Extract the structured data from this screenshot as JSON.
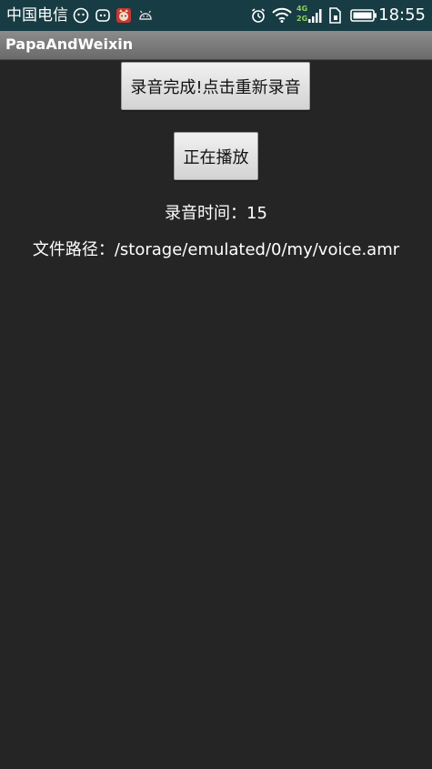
{
  "status_bar": {
    "carrier": "中国电信",
    "network_labels": [
      "4G",
      "2G"
    ],
    "time": "18:55",
    "background_color": "#173c44",
    "left_icons": [
      "wechat-icon",
      "chat-bubble-icon",
      "cat-app-icon",
      "android-icon"
    ],
    "right_icons": [
      "alarm-icon",
      "wifi-icon",
      "signal-icon",
      "sim-icon",
      "battery-icon"
    ]
  },
  "app_bar": {
    "title": "PapaAndWeixin"
  },
  "main": {
    "record_button_label": "录音完成!点击重新录音",
    "play_button_label": "正在播放",
    "record_time_label": "录音时间：",
    "record_time_value": "15",
    "file_path_label": "文件路径：",
    "file_path_value": "/storage/emulated/0/my/voice.amr"
  }
}
